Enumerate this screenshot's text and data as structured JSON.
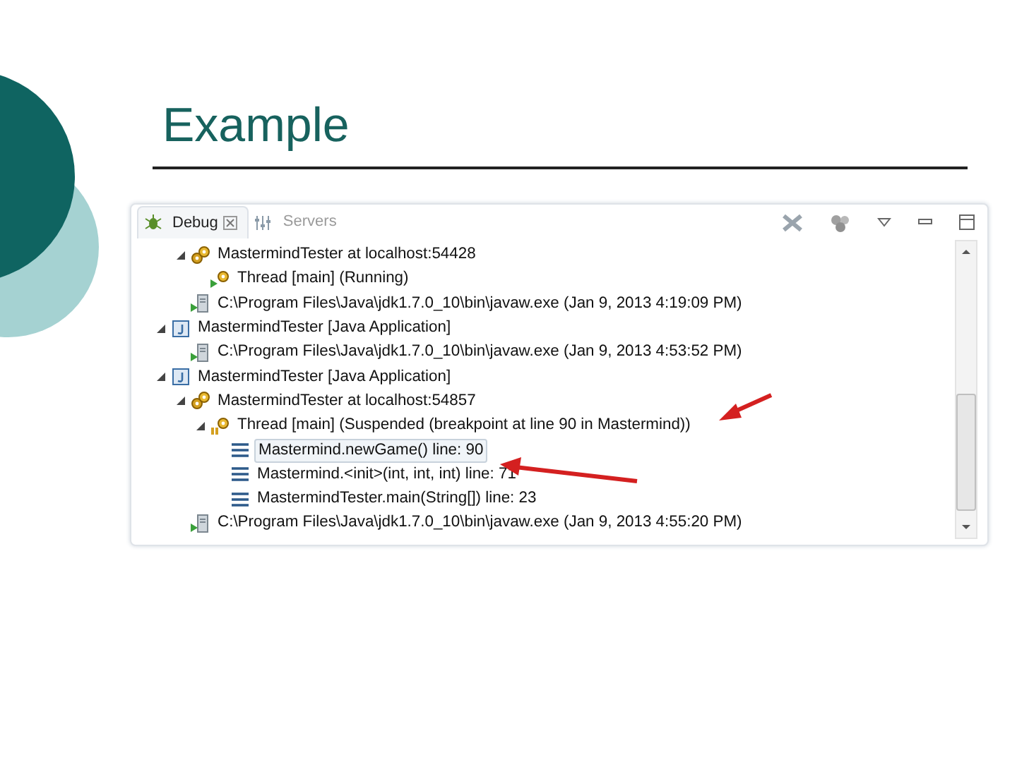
{
  "slide": {
    "title": "Example"
  },
  "view": {
    "tabs": [
      {
        "label": "Debug",
        "selected": true,
        "closable": true
      },
      {
        "label": "Servers",
        "selected": false,
        "closable": false
      }
    ]
  },
  "tree": [
    {
      "children": [
        {
          "kind": "target",
          "label": "MastermindTester at localhost:54428",
          "expanded": true,
          "children": [
            {
              "kind": "thread",
              "label": "Thread [main] (Running)",
              "running": true
            }
          ]
        },
        {
          "kind": "process",
          "label": "C:\\Program Files\\Java\\jdk1.7.0_10\\bin\\javaw.exe (Jan 9, 2013 4:19:09 PM)"
        }
      ]
    },
    {
      "kind": "launch",
      "label": "MastermindTester [Java Application]",
      "expanded": true,
      "children": [
        {
          "kind": "process",
          "label": "C:\\Program Files\\Java\\jdk1.7.0_10\\bin\\javaw.exe (Jan 9, 2013 4:53:52 PM)"
        }
      ]
    },
    {
      "kind": "launch",
      "label": "MastermindTester [Java Application]",
      "expanded": true,
      "children": [
        {
          "kind": "target",
          "label": "MastermindTester at localhost:54857",
          "expanded": true,
          "children": [
            {
              "kind": "thread",
              "label": "Thread [main] (Suspended (breakpoint at line 90 in Mastermind))",
              "running": false,
              "expanded": true,
              "children": [
                {
                  "kind": "frame",
                  "label": "Mastermind.newGame() line: 90",
                  "selected": true
                },
                {
                  "kind": "frame",
                  "label": "Mastermind.<init>(int, int, int) line: 71",
                  "selected": false
                },
                {
                  "kind": "frame",
                  "label": "MastermindTester.main(String[]) line: 23",
                  "selected": false
                }
              ]
            }
          ]
        },
        {
          "kind": "process",
          "label": "C:\\Program Files\\Java\\jdk1.7.0_10\\bin\\javaw.exe (Jan 9, 2013 4:55:20 PM)"
        }
      ]
    }
  ]
}
